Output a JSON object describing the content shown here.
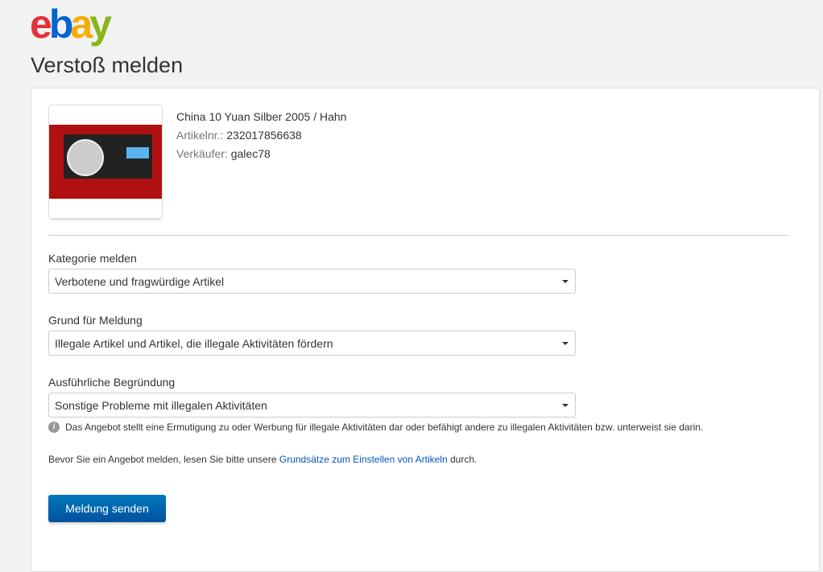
{
  "logo": "ebay",
  "title": "Verstoß melden",
  "item": {
    "title": "China 10 Yuan Silber 2005 / Hahn",
    "number_label": "Artikelnr.:",
    "number": "232017856638",
    "seller_label": "Verkäufer:",
    "seller": "galec78"
  },
  "fields": [
    {
      "label": "Kategorie melden",
      "value": "Verbotene und fragwürdige Artikel"
    },
    {
      "label": "Grund für Meldung",
      "value": "Illegale Artikel und Artikel, die illegale Aktivitäten fördern"
    },
    {
      "label": "Ausführliche Begründung",
      "value": "Sonstige Probleme mit illegalen Aktivitäten"
    }
  ],
  "hint": "Das Angebot stellt eine Ermutigung zu oder Werbung für illegale Aktivitäten dar oder befähigt andere zu illegalen Aktivitäten bzw. unterweist sie darin.",
  "note": {
    "before": "Bevor Sie ein Angebot melden, lesen Sie bitte unsere ",
    "link": "Grundsätze zum Einstellen von Artikeln",
    "after": " durch."
  },
  "submit": "Meldung senden"
}
